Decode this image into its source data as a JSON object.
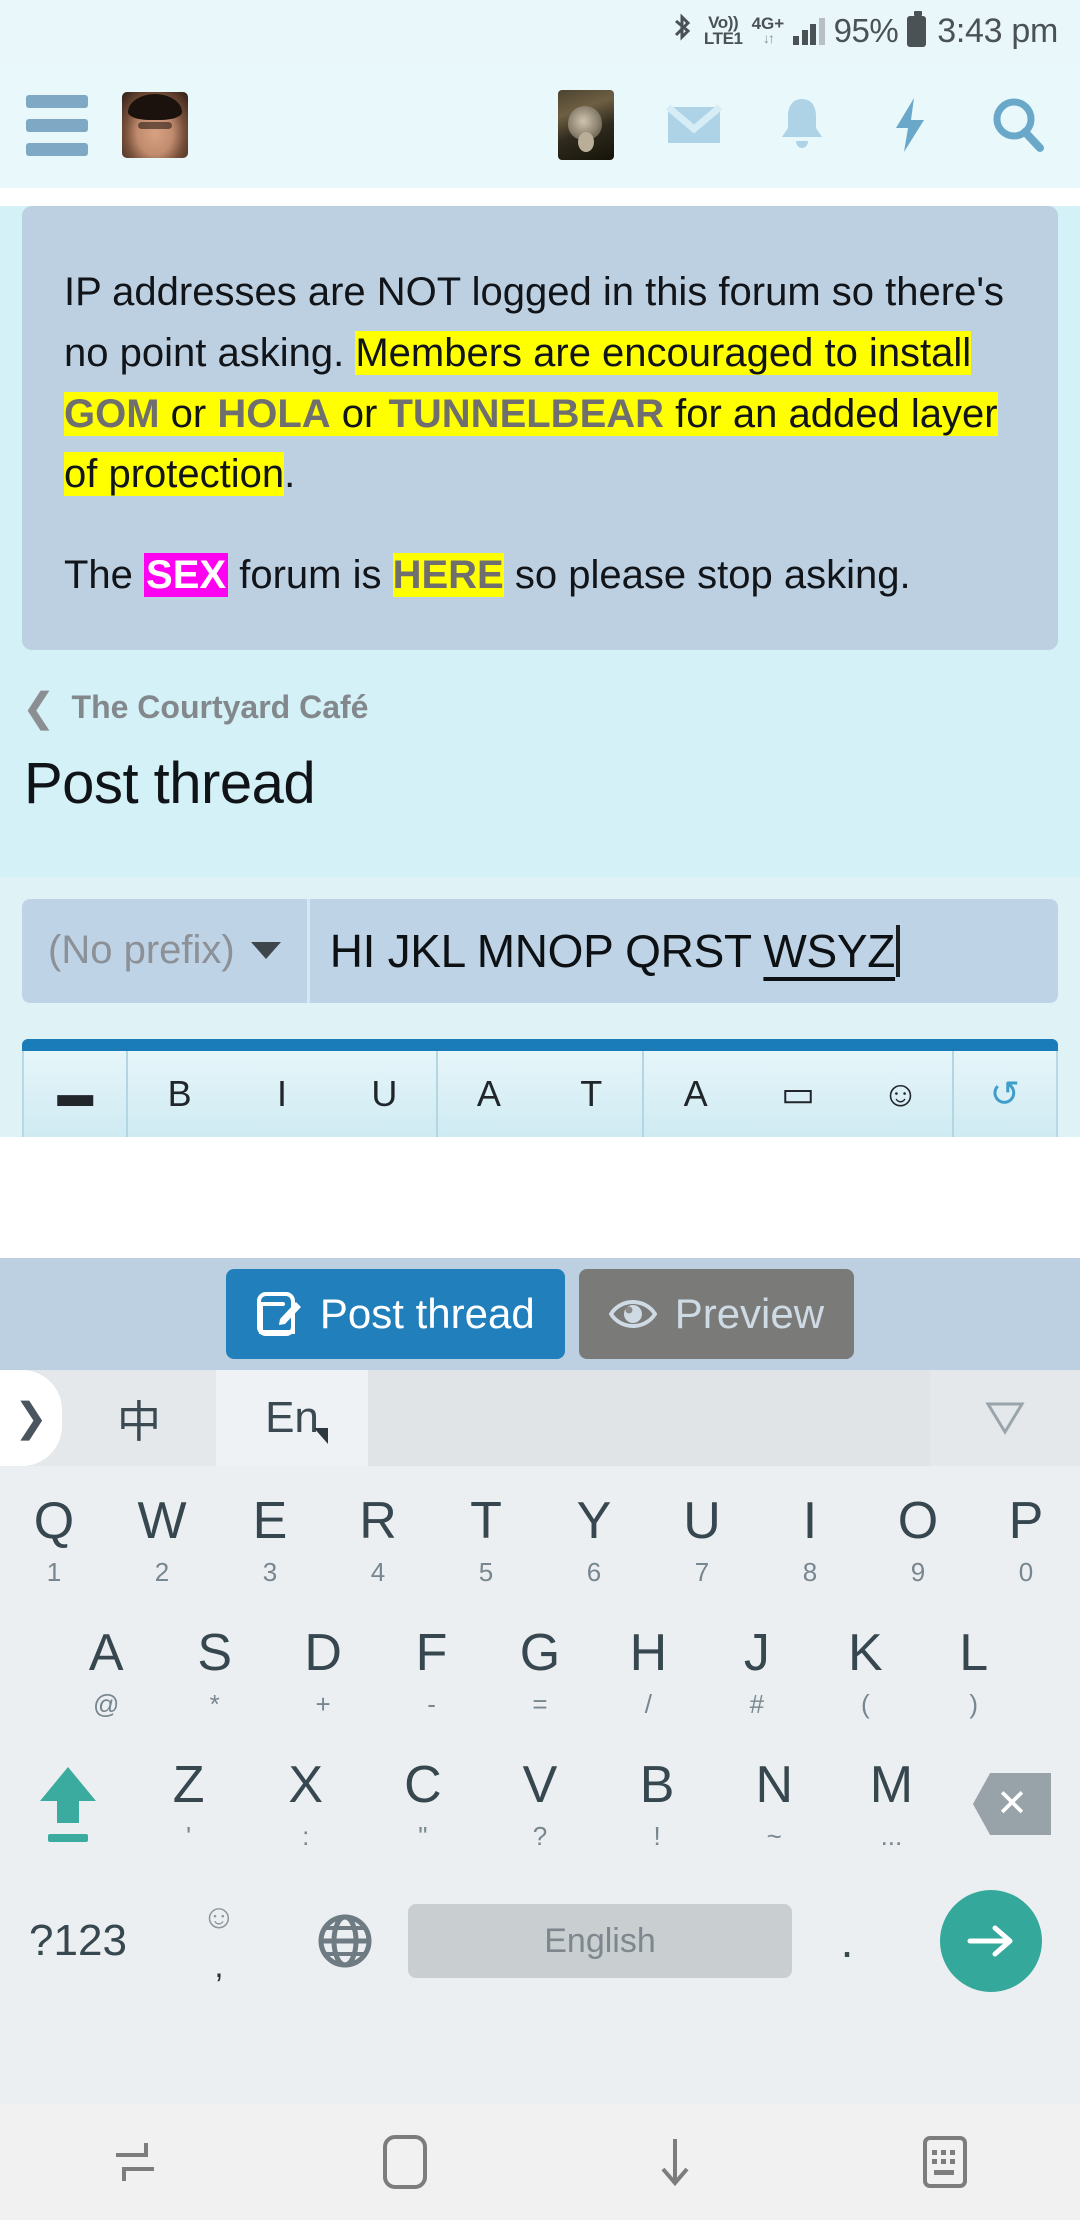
{
  "status_bar": {
    "bluetooth_icon": "bluetooth-icon",
    "volte_line1": "Vo))",
    "volte_line2": "LTE1",
    "network_type": "4G+",
    "data_arrows": "↓↑",
    "battery_percent": "95%",
    "time": "3:43 pm"
  },
  "app_header": {
    "menu_icon": "hamburger-menu-icon",
    "avatar_icon": "user-avatar",
    "thumbnail_icon": "monkey-thumbnail",
    "inbox_icon": "envelope-icon",
    "alerts_icon": "bell-icon",
    "whats_new_icon": "lightning-bolt-icon",
    "search_icon": "magnifier-icon"
  },
  "notice": {
    "p1_a": "IP addresses are NOT logged in this forum so there's no point asking. ",
    "p1_hl_start": "Members are encouraged to install ",
    "p1_gom": "GOM",
    "p1_or1": " or ",
    "p1_hola": "HOLA",
    "p1_or2": " or ",
    "p1_tunnelbear": "TUNNELBEAR",
    "p1_hl_end": " for an added layer of protection",
    "p1_period": ".",
    "p2_a": "The ",
    "p2_sex": "SEX",
    "p2_b": " forum is ",
    "p2_here": "HERE",
    "p2_c": " so please stop asking.",
    "highlight_yellow": "#ffff00",
    "highlight_pink": "#ff00f0"
  },
  "breadcrumb": {
    "back_icon": "chevron-left-icon",
    "label": "The Courtyard Café"
  },
  "page_title": "Post thread",
  "form": {
    "prefix_label": "(No prefix)",
    "prefix_caret_icon": "caret-down-icon",
    "title_value": "HI JKL MNOP QRST ",
    "title_composing": "WSYZ"
  },
  "editor_toolbar": {
    "tools": [
      {
        "icon": "remove-format-icon",
        "glyph": "▬"
      },
      {
        "icon": "bold-icon",
        "glyph": "B"
      },
      {
        "icon": "italic-icon",
        "glyph": "I"
      },
      {
        "icon": "underline-icon",
        "glyph": "U"
      },
      {
        "icon": "text-color-icon",
        "glyph": "A"
      },
      {
        "icon": "font-size-icon",
        "glyph": "T"
      },
      {
        "icon": "insert-icon",
        "glyph": "A"
      },
      {
        "icon": "quote-icon",
        "glyph": "▭"
      },
      {
        "icon": "smilie-icon",
        "glyph": "☺"
      },
      {
        "icon": "undo-icon",
        "glyph": "↺"
      }
    ]
  },
  "action_bar": {
    "post_icon": "compose-pencil-icon",
    "post_label": "Post thread",
    "preview_icon": "eye-icon",
    "preview_label": "Preview"
  },
  "keyboard": {
    "expand_icon": "chevron-right-icon",
    "tab_chinese": "中",
    "tab_english": "En",
    "more_icon": "triangle-down-icon",
    "row1": [
      {
        "main": "Q",
        "sub": "1"
      },
      {
        "main": "W",
        "sub": "2"
      },
      {
        "main": "E",
        "sub": "3"
      },
      {
        "main": "R",
        "sub": "4"
      },
      {
        "main": "T",
        "sub": "5"
      },
      {
        "main": "Y",
        "sub": "6"
      },
      {
        "main": "U",
        "sub": "7"
      },
      {
        "main": "I",
        "sub": "8"
      },
      {
        "main": "O",
        "sub": "9"
      },
      {
        "main": "P",
        "sub": "0"
      }
    ],
    "row2": [
      {
        "main": "A",
        "sub": "@"
      },
      {
        "main": "S",
        "sub": "*"
      },
      {
        "main": "D",
        "sub": "+"
      },
      {
        "main": "F",
        "sub": "-"
      },
      {
        "main": "G",
        "sub": "="
      },
      {
        "main": "H",
        "sub": "/"
      },
      {
        "main": "J",
        "sub": "#"
      },
      {
        "main": "K",
        "sub": "("
      },
      {
        "main": "L",
        "sub": ")"
      }
    ],
    "row3": [
      {
        "main": "Z",
        "sub": "'"
      },
      {
        "main": "X",
        "sub": ":"
      },
      {
        "main": "C",
        "sub": "\""
      },
      {
        "main": "V",
        "sub": "?"
      },
      {
        "main": "B",
        "sub": "!"
      },
      {
        "main": "N",
        "sub": "~"
      },
      {
        "main": "M",
        "sub": "..."
      }
    ],
    "shift_icon": "shift-caps-lock-icon",
    "delete_icon": "backspace-icon",
    "symbols_label": "?123",
    "emoji_icon": "emoji-smiley-icon",
    "emoji_sub": ",",
    "globe_icon": "language-globe-icon",
    "space_label": "English",
    "period_label": ".",
    "enter_icon": "arrow-right-enter-icon",
    "accent_color": "#35a89c"
  },
  "nav_bar": {
    "recents_icon": "recents-icon",
    "home_icon": "home-icon",
    "hide_keyboard_icon": "arrow-down-icon",
    "keyboard_switch_icon": "keyboard-icon"
  }
}
